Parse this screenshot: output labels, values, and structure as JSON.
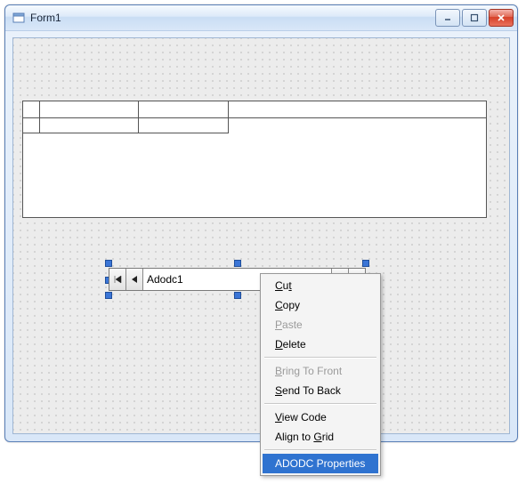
{
  "window": {
    "title": "Form1"
  },
  "adodc": {
    "caption": "Adodc1"
  },
  "contextMenu": {
    "cut": "Cut",
    "copy": "Copy",
    "paste": "Paste",
    "delete": "Delete",
    "bringToFront": "Bring To Front",
    "sendToBack": "Send To Back",
    "viewCode": "View Code",
    "alignToGrid": "Align to Grid",
    "adodcProperties": "ADODC Properties"
  }
}
